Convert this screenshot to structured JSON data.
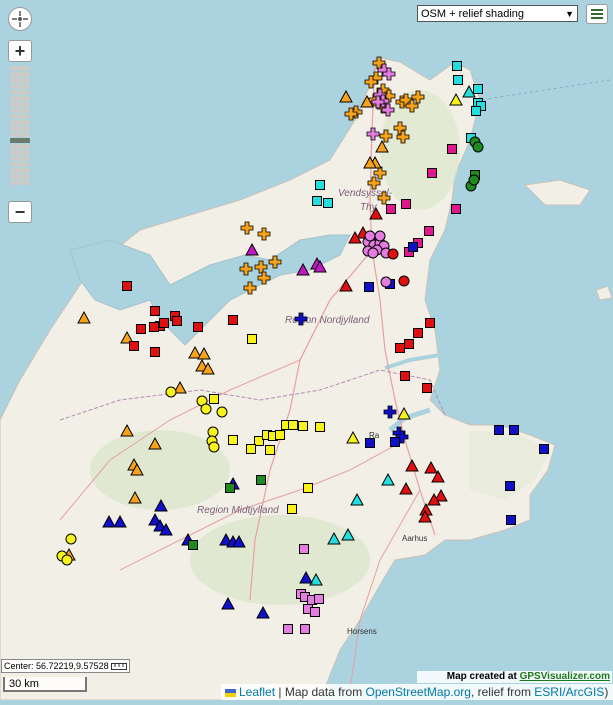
{
  "map": {
    "layer_select": {
      "selected": "OSM + relief shading"
    },
    "labels": {
      "vendsyssel": "Vendsyssel-",
      "thy": "Thy",
      "nordjylland": "Region Nordjylland",
      "midtjylland": "Region Midtjylland",
      "aarhus": "Aarhus",
      "horsens": "Horsens",
      "randers": "Ra"
    },
    "center_readout": "Center: 56.72219,9.57528",
    "scale_label": "30 km",
    "credit_prefix": "Map created at",
    "credit_link": "GPSVisualizer.com",
    "attribution": {
      "leaflet": "Leaflet",
      "sep1": " | Map data from ",
      "osm": "OpenStreetMap.org",
      "sep2": ", relief from ",
      "esri": "ESRI/ArcGIS",
      "end": ")"
    },
    "colors": {
      "water": "#aad3df",
      "land": "#f2efe6",
      "orange": "#f7a31a",
      "pink": "#e57de0",
      "cyan": "#22dede",
      "green": "#1f8a1f",
      "magenta": "#e0188f",
      "blue": "#1010c8",
      "red": "#e01010",
      "yellow": "#f6f21a"
    },
    "icons": {
      "center": "crosshair-icon",
      "menu": "hamburger-menu-icon",
      "ruler": "ruler-icon",
      "zoom_in": "+",
      "zoom_out": "−"
    }
  }
}
